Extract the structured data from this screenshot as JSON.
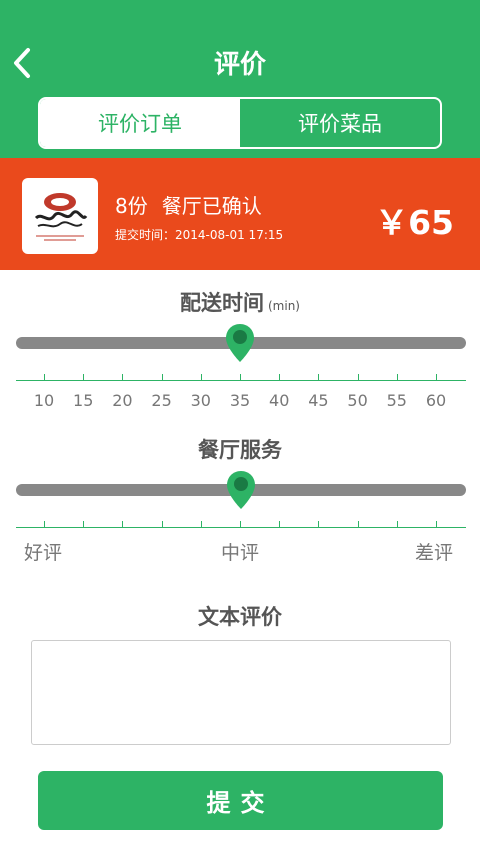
{
  "header": {
    "title": "评价",
    "tabs": [
      {
        "label": "评价订单",
        "active": true
      },
      {
        "label": "评价菜品",
        "active": false
      }
    ],
    "color": "#2db365"
  },
  "order": {
    "logo_text": "渔嘴巴",
    "quantity": "8份",
    "status": "餐厅已确认",
    "submit_time": "提交时间：2014-08-01   17:15",
    "price": "￥65",
    "color": "#ea4a1c"
  },
  "delivery": {
    "title": "配送时间",
    "unit": "(min)",
    "ticks": [
      "10",
      "15",
      "20",
      "25",
      "30",
      "35",
      "40",
      "45",
      "50",
      "55",
      "60"
    ],
    "value": 35
  },
  "service": {
    "title": "餐厅服务",
    "labels": {
      "good": "好评",
      "medium": "中评",
      "bad": "差评"
    },
    "value": "中评"
  },
  "comment": {
    "title": "文本评价",
    "text": ""
  },
  "submit": {
    "label": "提交"
  }
}
